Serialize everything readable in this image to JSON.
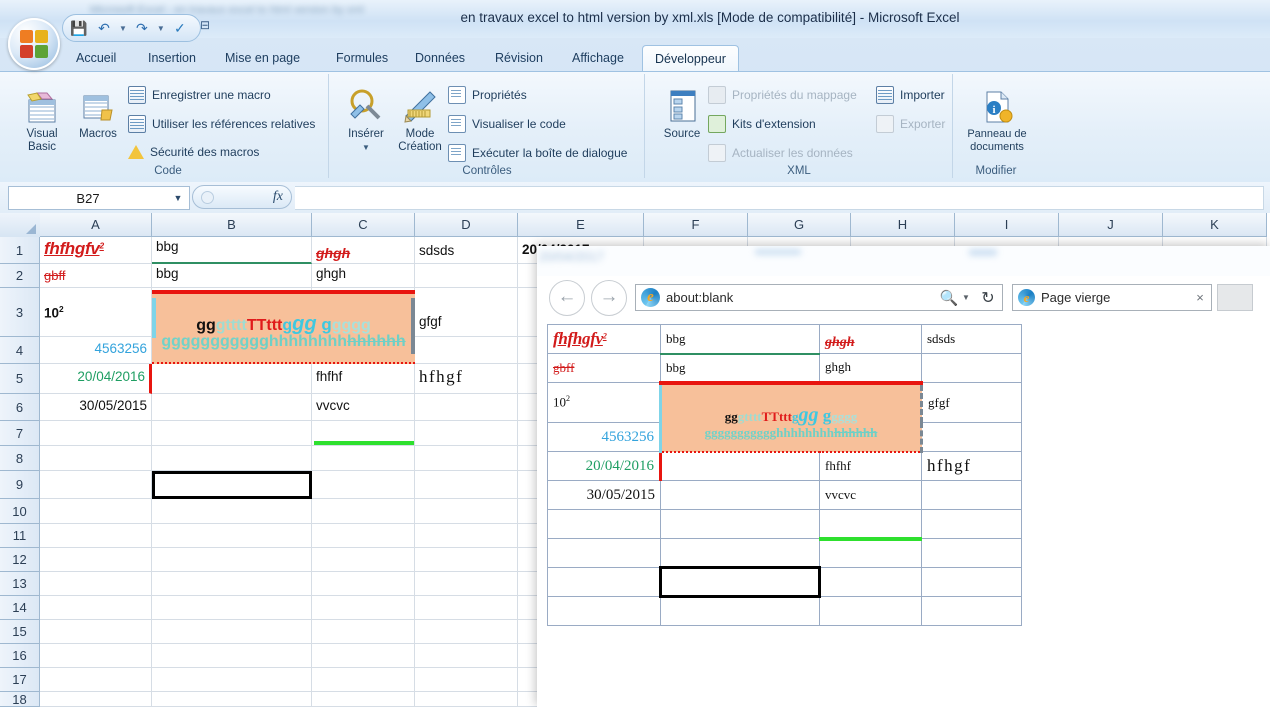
{
  "window": {
    "title": "en travaux excel to html version by xml.xls  [Mode de compatibilité] - Microsoft Excel",
    "blurred_title_hint": "Microsoft Excel  -  en travaux excel to html version by xml"
  },
  "quick_access": {
    "save_label": "Enregistrer",
    "undo_label": "Annuler",
    "redo_label": "Rétablir",
    "spell_label": "Orthographe",
    "customize_label": "Personnaliser la barre d'outils Accès rapide"
  },
  "ribbon": {
    "tabs": [
      {
        "label": "Accueil",
        "active": false
      },
      {
        "label": "Insertion",
        "active": false
      },
      {
        "label": "Mise en page",
        "active": false
      },
      {
        "label": "Formules",
        "active": false
      },
      {
        "label": "Données",
        "active": false
      },
      {
        "label": "Révision",
        "active": false
      },
      {
        "label": "Affichage",
        "active": false
      },
      {
        "label": "Développeur",
        "active": true
      }
    ],
    "groups": [
      {
        "title": "Code",
        "big_buttons": [
          {
            "label_line1": "Visual",
            "label_line2": "Basic",
            "icon": "visual-basic-icon"
          },
          {
            "label_line1": "Macros",
            "label_line2": "",
            "icon": "macros-icon"
          }
        ],
        "items": [
          {
            "label": "Enregistrer une macro",
            "icon": "record-macro-icon",
            "disabled": false
          },
          {
            "label": "Utiliser les références relatives",
            "icon": "relative-refs-icon",
            "disabled": false
          },
          {
            "label": "Sécurité des macros",
            "icon": "macro-security-icon",
            "disabled": false
          }
        ]
      },
      {
        "title": "Contrôles",
        "big_buttons": [
          {
            "label_line1": "Insérer",
            "label_line2": "",
            "icon": "insert-control-icon"
          },
          {
            "label_line1": "Mode",
            "label_line2": "Création",
            "icon": "design-mode-icon"
          }
        ],
        "items": [
          {
            "label": "Propriétés",
            "icon": "properties-icon",
            "disabled": false
          },
          {
            "label": "Visualiser le code",
            "icon": "view-code-icon",
            "disabled": false
          },
          {
            "label": "Exécuter la boîte de dialogue",
            "icon": "run-dialog-icon",
            "disabled": false
          }
        ]
      },
      {
        "title": "XML",
        "big_buttons": [
          {
            "label_line1": "Source",
            "label_line2": "",
            "icon": "xml-source-icon"
          }
        ],
        "items": [
          {
            "label": "Propriétés du mappage",
            "icon": "map-properties-icon",
            "disabled": true
          },
          {
            "label": "Kits d'extension",
            "icon": "expansion-packs-icon",
            "disabled": false
          },
          {
            "label": "Actualiser les données",
            "icon": "refresh-data-icon",
            "disabled": true
          },
          {
            "label": "Importer",
            "icon": "import-icon",
            "disabled": false
          },
          {
            "label": "Exporter",
            "icon": "export-icon",
            "disabled": true
          }
        ]
      },
      {
        "title": "Modifier",
        "big_buttons": [
          {
            "label_line1": "Panneau de",
            "label_line2": "documents",
            "icon": "document-panel-icon"
          }
        ],
        "items": []
      }
    ]
  },
  "formula_bar": {
    "name_box_value": "B27",
    "formula_value": "",
    "fx_label": "fx",
    "insert_function_tooltip": "Insérer une fonction"
  },
  "sheet": {
    "columns": [
      "A",
      "B",
      "C",
      "D",
      "E",
      "F",
      "G",
      "H",
      "I",
      "J",
      "K"
    ],
    "rows": [
      "1",
      "2",
      "3",
      "4",
      "5",
      "6",
      "7",
      "8",
      "9",
      "10",
      "11",
      "12",
      "13",
      "14",
      "15",
      "16",
      "17",
      "18"
    ],
    "cells": {
      "A1": "fhfhgfv",
      "A1_sup": "2",
      "B1": "bbg",
      "C1": "ghgh",
      "D1": "sdsds",
      "E1": "20/04/2017",
      "A2": "gbff",
      "B2": "bbg",
      "C2": "ghgh",
      "A3": "10",
      "A3_sup": "2",
      "D3": "gfgf",
      "A4": "4563256",
      "A5": "20/04/2016",
      "C5": "fhfhf",
      "D5": "hfhgf",
      "A6": "30/05/2015",
      "C6": "vvcvc",
      "merged_B3_C4": {
        "line1": [
          {
            "text": "gg",
            "style": "m-gg"
          },
          {
            "text": "gtttt",
            "style": "m-gtttt"
          },
          {
            "text": "TTttt",
            "style": "m-TT"
          },
          {
            "text": "g",
            "style": "m-tg"
          },
          {
            "text": "gg",
            "style": "m-gg2"
          },
          {
            "text": " g",
            "style": "m-g3"
          },
          {
            "text": "gggg",
            "style": "m-tail"
          }
        ],
        "line2": [
          {
            "text": "ggggggggg",
            "style": "m-line2a"
          },
          {
            "text": "gg",
            "style": "m-line2b"
          },
          {
            "text": "hhhhhhhh",
            "style": "m-line2b"
          },
          {
            "text": "hhhhhh",
            "style": "m-line2c"
          }
        ]
      }
    },
    "selection_name": "B9"
  },
  "browser": {
    "back_label": "Précédent",
    "forward_label": "Suivant",
    "address_value": "about:blank",
    "search_icon": "search-icon",
    "refresh_icon": "refresh-icon",
    "tab_title": "Page vierge",
    "tab_close_label": "×",
    "favicon": "internet-explorer-icon"
  },
  "colors": {
    "accent_red": "#d21b1b",
    "merged_fill": "#f7c09a",
    "merged_top_border": "#e8150f",
    "green_line": "#2ee02e",
    "blue_number": "#33a3dc",
    "green_date": "#1f9e63",
    "teal_text": "#6fd0c6"
  }
}
